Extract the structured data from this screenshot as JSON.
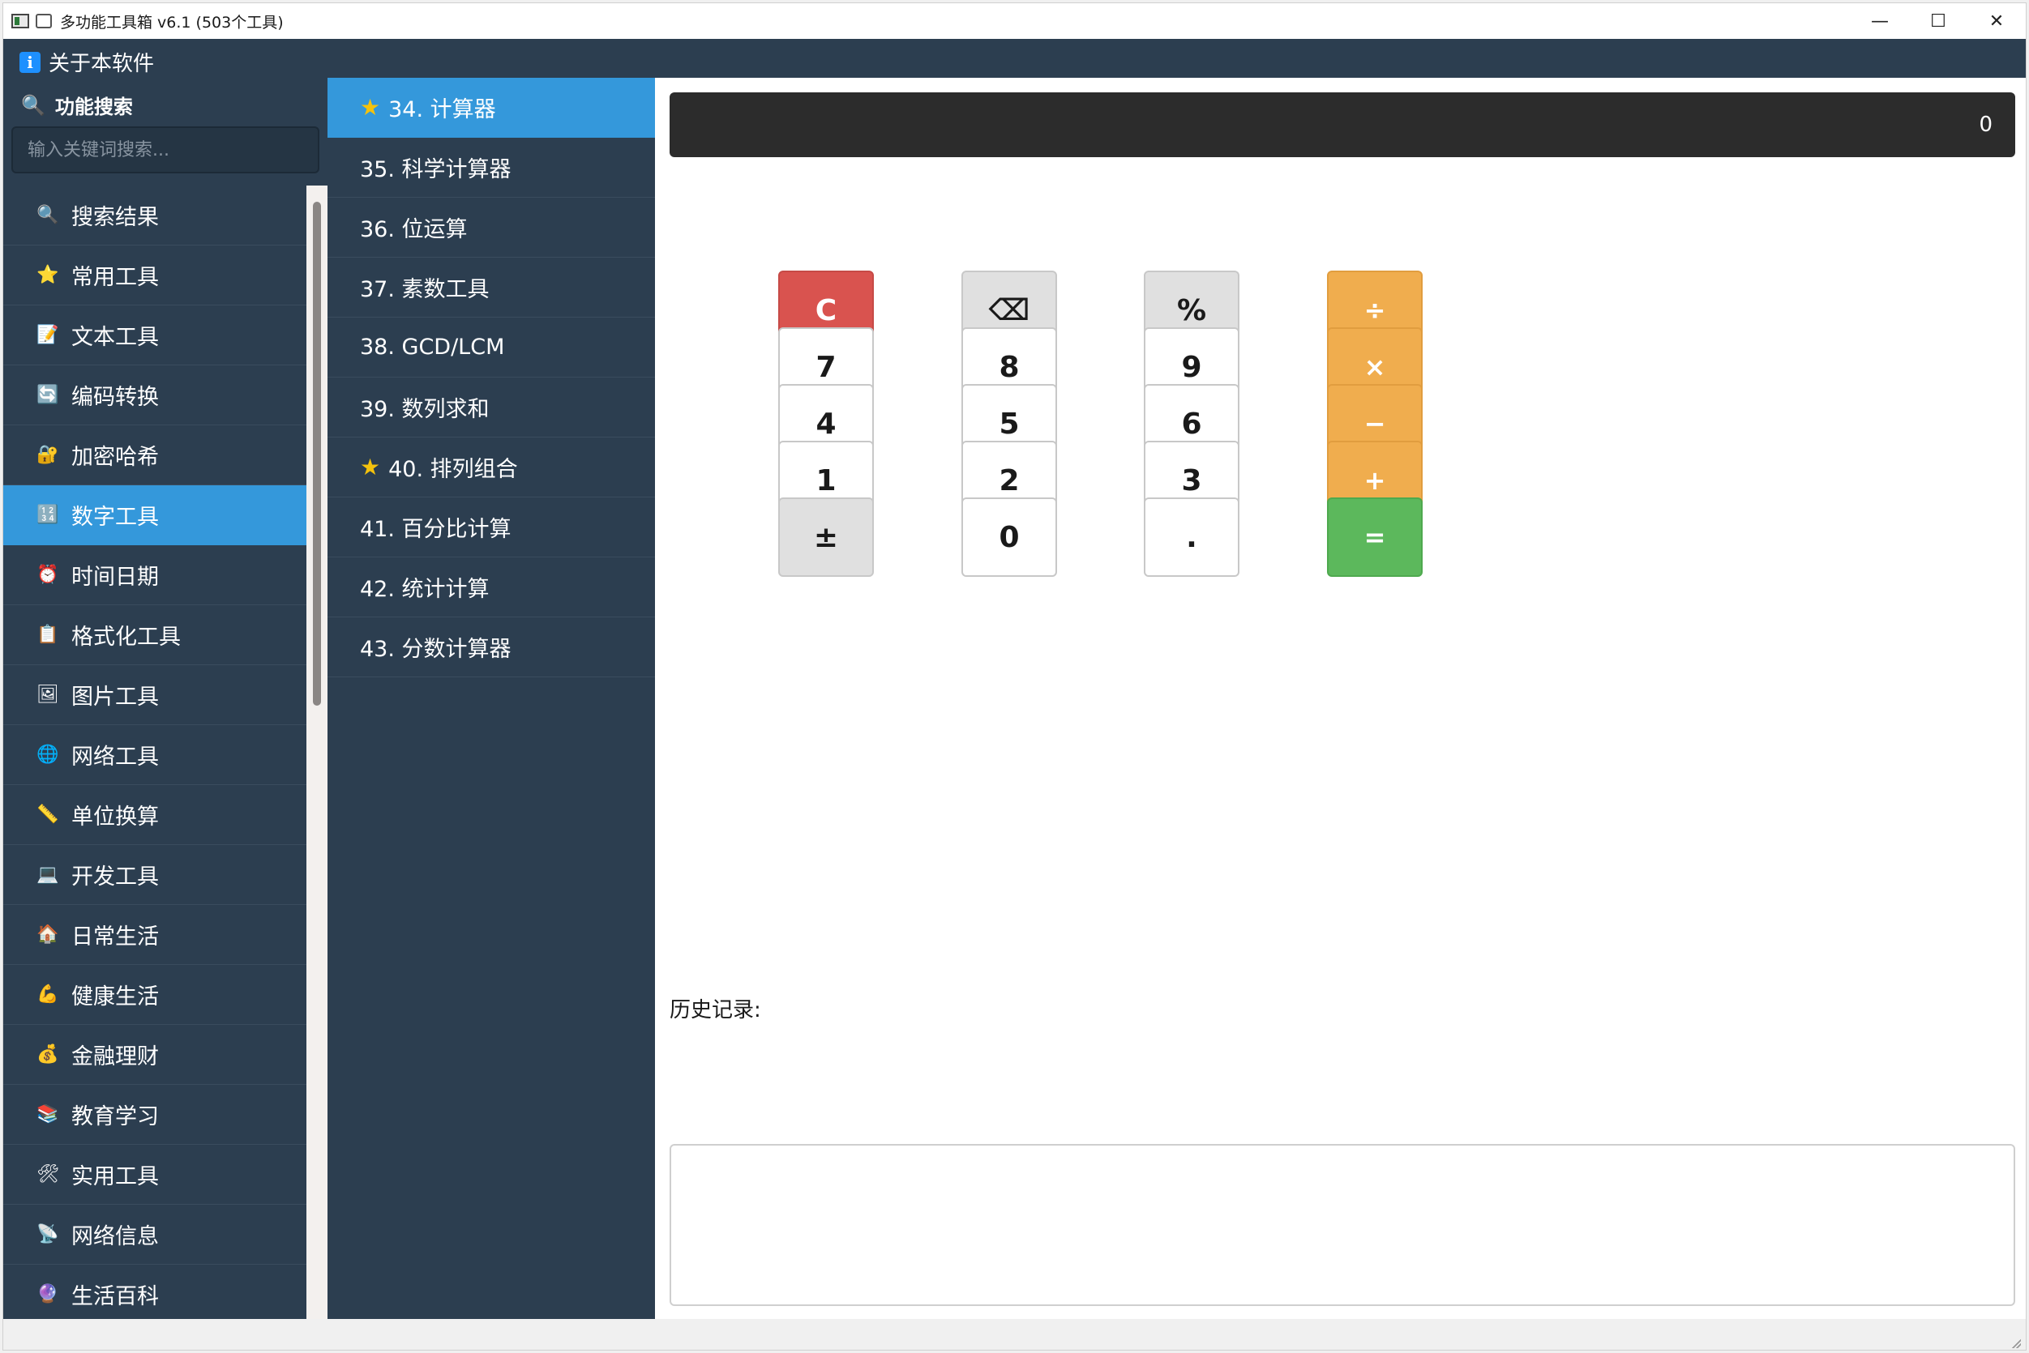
{
  "window": {
    "title": "多功能工具箱 v6.1 (503个工具)",
    "controls": {
      "minimize": "—",
      "maximize": "☐",
      "close": "✕"
    }
  },
  "menubar": {
    "about_label": "关于本软件",
    "about_icon": "i"
  },
  "sidebar": {
    "search_label": "功能搜索",
    "search_placeholder": "输入关键词搜索...",
    "search_value": "",
    "categories": [
      {
        "label": "搜索结果",
        "icon": "🔍",
        "active": false
      },
      {
        "label": "常用工具",
        "icon": "⭐",
        "active": false
      },
      {
        "label": "文本工具",
        "icon": "📝",
        "active": false
      },
      {
        "label": "编码转换",
        "icon": "🔄",
        "active": false
      },
      {
        "label": "加密哈希",
        "icon": "🔐",
        "active": false
      },
      {
        "label": "数字工具",
        "icon": "🔢",
        "active": true
      },
      {
        "label": "时间日期",
        "icon": "⏰",
        "active": false
      },
      {
        "label": "格式化工具",
        "icon": "📋",
        "active": false
      },
      {
        "label": "图片工具",
        "icon": "🖼",
        "active": false
      },
      {
        "label": "网络工具",
        "icon": "🌐",
        "active": false
      },
      {
        "label": "单位换算",
        "icon": "📏",
        "active": false
      },
      {
        "label": "开发工具",
        "icon": "💻",
        "active": false
      },
      {
        "label": "日常生活",
        "icon": "🏠",
        "active": false
      },
      {
        "label": "健康生活",
        "icon": "💪",
        "active": false
      },
      {
        "label": "金融理财",
        "icon": "💰",
        "active": false
      },
      {
        "label": "教育学习",
        "icon": "📚",
        "active": false
      },
      {
        "label": "实用工具",
        "icon": "🛠",
        "active": false
      },
      {
        "label": "网络信息",
        "icon": "📡",
        "active": false
      },
      {
        "label": "生活百科",
        "icon": "🔮",
        "active": false
      }
    ]
  },
  "tools": [
    {
      "label": "34. 计算器",
      "starred": true,
      "active": true
    },
    {
      "label": "35. 科学计算器",
      "starred": false,
      "active": false
    },
    {
      "label": "36. 位运算",
      "starred": false,
      "active": false
    },
    {
      "label": "37. 素数工具",
      "starred": false,
      "active": false
    },
    {
      "label": "38. GCD/LCM",
      "starred": false,
      "active": false
    },
    {
      "label": "39. 数列求和",
      "starred": false,
      "active": false
    },
    {
      "label": "40. 排列组合",
      "starred": true,
      "active": false
    },
    {
      "label": "41. 百分比计算",
      "starred": false,
      "active": false
    },
    {
      "label": "42. 统计计算",
      "starred": false,
      "active": false
    },
    {
      "label": "43. 分数计算器",
      "starred": false,
      "active": false
    }
  ],
  "calculator": {
    "display": "0",
    "keys": [
      [
        {
          "label": "C",
          "style": "red"
        },
        {
          "label": "⌫",
          "style": "gray"
        },
        {
          "label": "%",
          "style": "gray"
        },
        {
          "label": "÷",
          "style": "orange"
        }
      ],
      [
        {
          "label": "7",
          "style": "num"
        },
        {
          "label": "8",
          "style": "num"
        },
        {
          "label": "9",
          "style": "num"
        },
        {
          "label": "×",
          "style": "orange"
        }
      ],
      [
        {
          "label": "4",
          "style": "num"
        },
        {
          "label": "5",
          "style": "num"
        },
        {
          "label": "6",
          "style": "num"
        },
        {
          "label": "−",
          "style": "orange"
        }
      ],
      [
        {
          "label": "1",
          "style": "num"
        },
        {
          "label": "2",
          "style": "num"
        },
        {
          "label": "3",
          "style": "num"
        },
        {
          "label": "+",
          "style": "orange"
        }
      ],
      [
        {
          "label": "±",
          "style": "gray"
        },
        {
          "label": "0",
          "style": "num"
        },
        {
          "label": ".",
          "style": "num"
        },
        {
          "label": "=",
          "style": "green"
        }
      ]
    ],
    "history_label": "历史记录:",
    "history_text": ""
  },
  "colors": {
    "sidebar_bg": "#2c3e50",
    "active_bg": "#3498db",
    "clear_red": "#d9534f",
    "operator_orange": "#f0ad4e",
    "equals_green": "#5cb85c"
  }
}
